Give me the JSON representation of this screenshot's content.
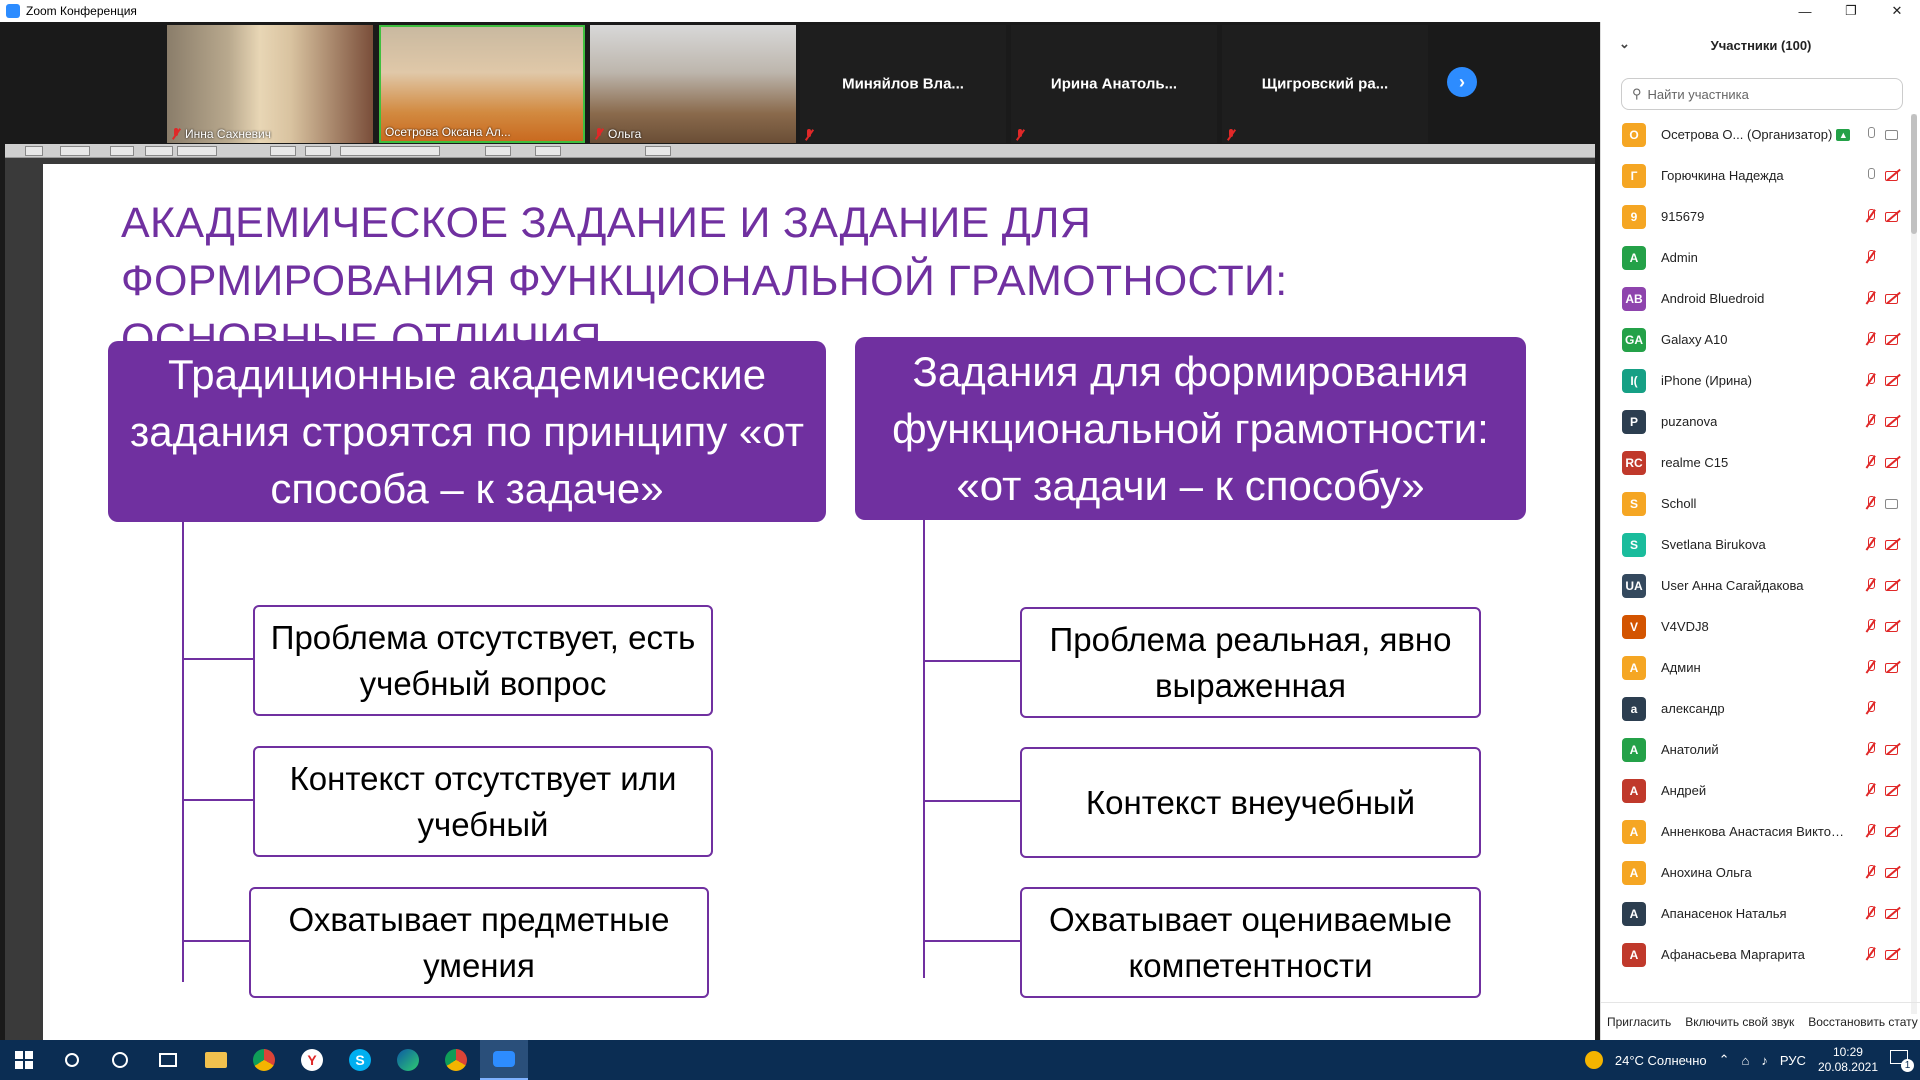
{
  "window": {
    "title": "Zoom Конференция",
    "minimize": "—",
    "restore": "❐",
    "close": "✕"
  },
  "gallery": {
    "tiles": [
      {
        "name": "Инна Сахневич",
        "muted": true,
        "video": true
      },
      {
        "name": "Осетрова Оксана Ал...",
        "muted": false,
        "video": true
      },
      {
        "name": "Ольга",
        "muted": true,
        "video": true
      },
      {
        "name": "Миняйлов Вла...",
        "muted": true,
        "video": false
      },
      {
        "name": "Ирина Анатоль...",
        "muted": true,
        "video": false
      },
      {
        "name": "Щигровский ра...",
        "muted": true,
        "video": false
      }
    ],
    "next_arrow": "›"
  },
  "slide": {
    "title": "АКАДЕМИЧЕСКОЕ ЗАДАНИЕ И ЗАДАНИЕ ДЛЯ ФОРМИРОВАНИЯ ФУНКЦИОНАЛЬНОЙ ГРАМОТНОСТИ: ОСНОВНЫЕ ОТЛИЧИЯ",
    "left": {
      "header": "Традиционные академические задания строятся по принципу «от способа – к задаче»",
      "items": [
        "Проблема отсутствует, есть учебный вопрос",
        "Контекст отсутствует или учебный",
        "Охватывает предметные умения"
      ]
    },
    "right": {
      "header": "Задания для формирования функциональной грамотности: «от задачи – к способу»",
      "items": [
        "Проблема реальная, явно выраженная",
        "Контекст внеучебный",
        "Охватывает оцениваемые компетентности"
      ]
    },
    "accent": "#7030a0"
  },
  "participants": {
    "header": "Участники (100)",
    "search_placeholder": "Найти участника",
    "list": [
      {
        "initials": "О",
        "color": "#f5a623",
        "name": "Осетрова О... (Организатор)",
        "mic_off": false,
        "cam_off": false,
        "host": true
      },
      {
        "initials": "Г",
        "color": "#f5a623",
        "name": "Горючкина Надежда",
        "mic_off": false,
        "cam_off": true
      },
      {
        "initials": "9",
        "color": "#f5a623",
        "name": "915679",
        "mic_off": true,
        "cam_off": true
      },
      {
        "initials": "A",
        "color": "#24a148",
        "name": "Admin",
        "mic_off": true,
        "cam_off": false,
        "no_cam": true
      },
      {
        "initials": "AB",
        "color": "#8e44ad",
        "name": "Android Bluedroid",
        "mic_off": true,
        "cam_off": true
      },
      {
        "initials": "GA",
        "color": "#24a148",
        "name": "Galaxy A10",
        "mic_off": true,
        "cam_off": true
      },
      {
        "initials": "I(",
        "color": "#16a085",
        "name": "iPhone (Ирина)",
        "mic_off": true,
        "cam_off": true
      },
      {
        "initials": "P",
        "color": "#2c3e50",
        "name": "puzanova",
        "mic_off": true,
        "cam_off": true
      },
      {
        "initials": "RC",
        "color": "#c0392b",
        "name": "realme C15",
        "mic_off": true,
        "cam_off": true
      },
      {
        "initials": "S",
        "color": "#f5a623",
        "name": "Scholl",
        "mic_off": true,
        "cam_off": false
      },
      {
        "initials": "S",
        "color": "#1abc9c",
        "name": "Svetlana Birukova",
        "mic_off": true,
        "cam_off": true
      },
      {
        "initials": "UA",
        "color": "#34495e",
        "name": "User Анна Сагайдакова",
        "mic_off": true,
        "cam_off": true
      },
      {
        "initials": "V",
        "color": "#d35400",
        "name": "V4VDJ8",
        "mic_off": true,
        "cam_off": true
      },
      {
        "initials": "А",
        "color": "#f5a623",
        "name": "Админ",
        "mic_off": true,
        "cam_off": true
      },
      {
        "initials": "а",
        "color": "#2c3e50",
        "name": "александр",
        "mic_off": true,
        "cam_off": false,
        "no_cam": true
      },
      {
        "initials": "А",
        "color": "#24a148",
        "name": "Анатолий",
        "mic_off": true,
        "cam_off": true
      },
      {
        "initials": "А",
        "color": "#c0392b",
        "name": "Андрей",
        "mic_off": true,
        "cam_off": true
      },
      {
        "initials": "А",
        "color": "#f5a623",
        "name": "Анненкова Анастасия Викторо...",
        "mic_off": true,
        "cam_off": true
      },
      {
        "initials": "А",
        "color": "#f5a623",
        "name": "Анохина Ольга",
        "mic_off": true,
        "cam_off": true
      },
      {
        "initials": "А",
        "color": "#2c3e50",
        "name": "Апанасенок Наталья",
        "mic_off": true,
        "cam_off": true
      },
      {
        "initials": "А",
        "color": "#c0392b",
        "name": "Афанасьева Маргарита",
        "mic_off": true,
        "cam_off": true
      }
    ],
    "footer": {
      "invite": "Пригласить",
      "unmute": "Включить свой звук",
      "restore": "Восстановить стату"
    }
  },
  "taskbar": {
    "weather": "24°C Солнечно",
    "lang": "РУС",
    "time": "10:29",
    "date": "20.08.2021",
    "notifications": "1"
  }
}
